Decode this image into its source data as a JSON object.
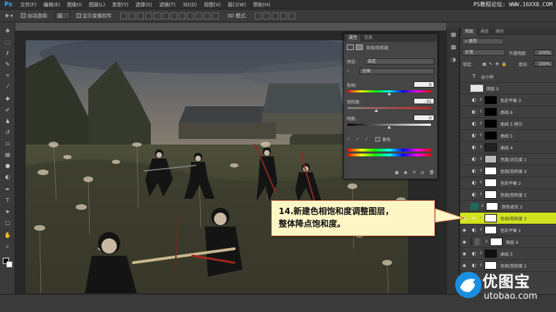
{
  "app": {
    "logo": "Ps",
    "menu": [
      "文件(F)",
      "编辑(E)",
      "图像(I)",
      "图层(L)",
      "类型(Y)",
      "选择(S)",
      "滤镜(T)",
      "3D(D)",
      "视图(V)",
      "窗口(W)",
      "帮助(H)"
    ],
    "watermark": "PS教程论坛: WWW.16XX8.COM"
  },
  "options": {
    "auto_select_label": "自动选择:",
    "auto_select_value": "组",
    "show_transform_label": "显示变换控件",
    "mode_3d": "3D 模式:"
  },
  "properties": {
    "tabs": [
      "属性",
      "信息"
    ],
    "panel_title": "色相/饱和度",
    "preset_label": "预设:",
    "preset_value": "自定",
    "channel_value": "全图",
    "hue_label": "色相:",
    "hue_value": "0",
    "saturation_label": "饱和度:",
    "saturation_value": "-31",
    "lightness_label": "明度:",
    "lightness_value": "0",
    "colorize_label": "着色",
    "hue_pos": 0.5,
    "saturation_pos": 0.345,
    "lightness_pos": 0.5
  },
  "layers": {
    "tabs": [
      "图层",
      "通道",
      "路径"
    ],
    "filter_type": "类型",
    "blend_mode": "正常",
    "opacity_label": "不透明度:",
    "opacity_value": "100%",
    "lock_label": "锁定:",
    "fill_label": "填充:",
    "fill_value": "100%",
    "items": [
      {
        "name": "@小祥",
        "kind": "text",
        "visible": false,
        "selected": false
      },
      {
        "name": "图层 5",
        "kind": "transparent",
        "visible": false,
        "selected": false
      },
      {
        "name": "色彩平衡 3",
        "kind": "adj",
        "mask": "#000000",
        "visible": false,
        "selected": false
      },
      {
        "name": "曲线 6",
        "kind": "adj",
        "mask": "#000000",
        "visible": false,
        "selected": false
      },
      {
        "name": "曲线 5 拷贝",
        "kind": "adj",
        "mask": "#000000",
        "visible": false,
        "selected": false
      },
      {
        "name": "曲线 5",
        "kind": "adj",
        "mask": "#000000",
        "visible": false,
        "selected": false
      },
      {
        "name": "曲线 4",
        "kind": "adj",
        "mask": "#222222",
        "visible": false,
        "selected": false
      },
      {
        "name": "亮度/对比度 1",
        "kind": "adj",
        "mask": "#bbbbbb",
        "visible": false,
        "selected": false
      },
      {
        "name": "色相/饱和度 4",
        "kind": "adj",
        "mask": "#ffffff",
        "visible": false,
        "selected": false
      },
      {
        "name": "色彩平衡 2",
        "kind": "adj",
        "mask": "#ffffff",
        "visible": false,
        "selected": false
      },
      {
        "name": "色相/饱和度 5",
        "kind": "adj",
        "mask": "#ffffff",
        "visible": false,
        "selected": false
      },
      {
        "name": "颜色填充 2",
        "kind": "fill",
        "mask": "#ffffff",
        "visible": false,
        "selected": false
      },
      {
        "name": "色相/饱和度 3",
        "kind": "adj",
        "mask": "#ffffff",
        "visible": true,
        "selected": true
      },
      {
        "name": "色彩平衡 1",
        "kind": "adj",
        "mask": "#ffffff",
        "visible": true,
        "selected": false
      },
      {
        "name": "图层 4",
        "kind": "image",
        "mask": "#ffffff",
        "visible": true,
        "selected": false
      },
      {
        "name": "曲线 3",
        "kind": "adj",
        "mask": "#111111",
        "visible": true,
        "selected": false
      },
      {
        "name": "色相/饱和度 2",
        "kind": "adj",
        "mask": "#ffffff",
        "visible": true,
        "selected": false
      }
    ]
  },
  "callout": {
    "line1": "14.新建色相饱和度调整图层，",
    "line2": "整体降点饱和度。"
  },
  "brand": {
    "name": "优图宝",
    "url": "utobao.com"
  },
  "colors": {
    "accent": "#31a8ff",
    "selected_layer": "#d2e21f",
    "callout_bg": "#fff6c6",
    "callout_border": "#c25a3a",
    "fill_layer": "#1e6b5a"
  }
}
